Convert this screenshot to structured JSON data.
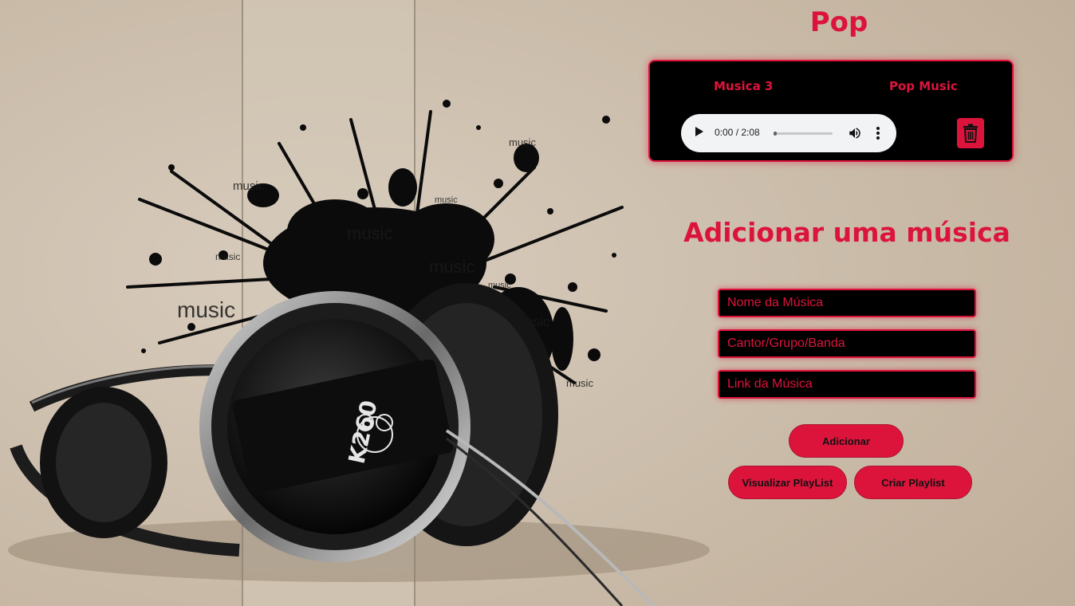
{
  "playlist": {
    "title": "Pop",
    "songs": [
      {
        "name": "Musica 3",
        "artist": "Pop Music",
        "player": {
          "time": "0:00 / 2:08",
          "progress": 0
        }
      }
    ]
  },
  "form": {
    "title": "Adicionar uma música",
    "song_name_placeholder": "Nome da Música",
    "artist_placeholder": "Cantor/Grupo/Banda",
    "link_placeholder": "Link da Música",
    "add_label": "Adicionar",
    "view_label": "Visualizar PlayList",
    "create_label": "Criar Playlist"
  },
  "background": {
    "headphone_model": "K260",
    "brand": "AKG",
    "splash_word": "music"
  },
  "colors": {
    "accent": "#dc143c",
    "panel": "#000000",
    "paper": "#c9bba9"
  }
}
